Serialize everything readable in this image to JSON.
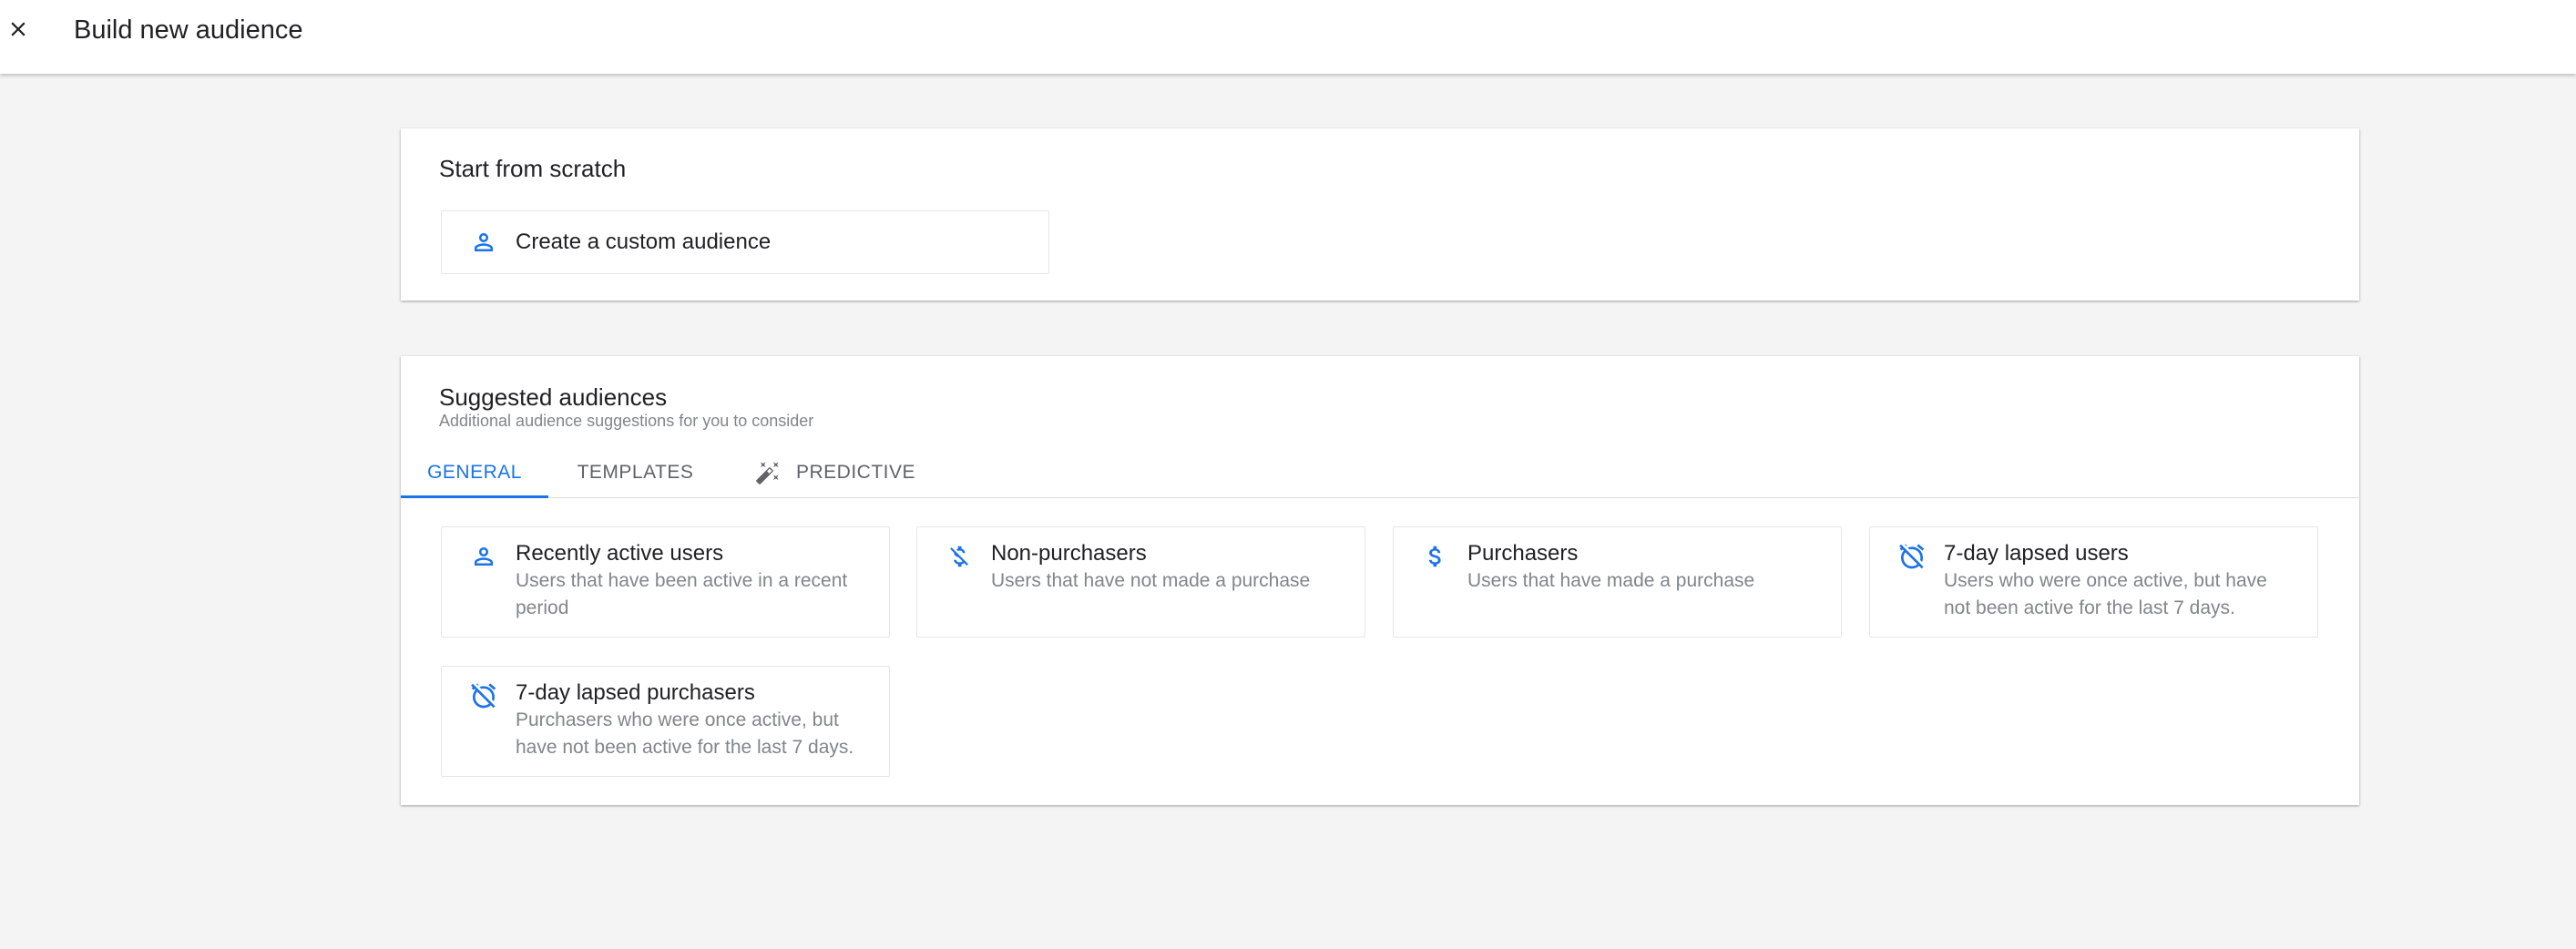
{
  "header": {
    "title": "Build new audience",
    "close_icon": "close-icon"
  },
  "scratch": {
    "title": "Start from scratch",
    "custom_option": {
      "label": "Create a custom audience",
      "icon": "person-icon"
    }
  },
  "suggested": {
    "title": "Suggested audiences",
    "subtitle": "Additional audience suggestions for you to consider",
    "tabs": [
      {
        "label": "GENERAL",
        "active": true
      },
      {
        "label": "TEMPLATES",
        "active": false
      },
      {
        "label": "PREDICTIVE",
        "active": false,
        "icon": "magic-wand-icon"
      }
    ],
    "audiences": [
      {
        "title": "Recently active users",
        "description": "Users that have been active in a recent period",
        "icon": "person-icon"
      },
      {
        "title": "Non-purchasers",
        "description": "Users that have not made a purchase",
        "icon": "money-off-icon"
      },
      {
        "title": "Purchasers",
        "description": "Users that have made a purchase",
        "icon": "dollar-icon"
      },
      {
        "title": "7-day lapsed users",
        "description": "Users who were once active, but have not been active for the last 7 days.",
        "icon": "alarm-off-icon"
      },
      {
        "title": "7-day lapsed purchasers",
        "description": "Purchasers who were once active, but have not been active for the last 7 days.",
        "icon": "alarm-off-icon"
      }
    ]
  },
  "colors": {
    "accent": "#1a73e8",
    "text_primary": "#202124",
    "text_secondary": "#80868b",
    "background": "#f4f4f4"
  }
}
